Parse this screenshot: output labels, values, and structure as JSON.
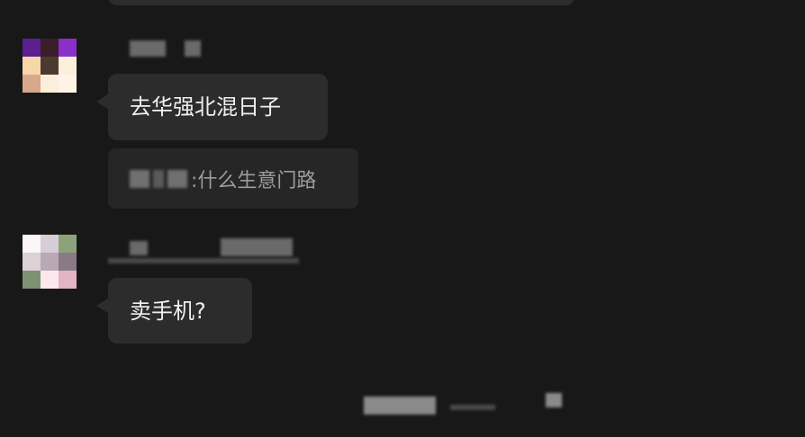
{
  "messages": [
    {
      "bubble_text": "去华强北混日子",
      "quote_text": ":什么生意门路"
    },
    {
      "bubble_text": "卖手机?"
    }
  ],
  "colors": {
    "background": "#181818",
    "bubble": "#2c2c2c",
    "bubble_text": "#f0f0f0",
    "quote_text": "#9c9c9c"
  },
  "icons": {
    "avatar_1": "pixel-avatar-purple",
    "avatar_2": "pixel-avatar-pastel"
  }
}
